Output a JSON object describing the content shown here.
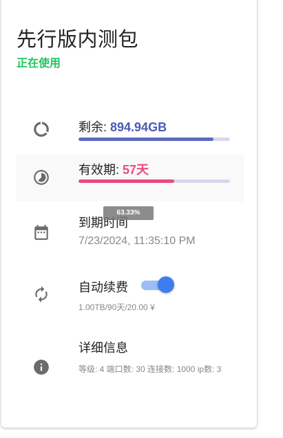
{
  "plan": {
    "title": "先行版内测包",
    "status": "正在使用"
  },
  "remaining": {
    "label": "剩余: ",
    "value": "894.94GB",
    "progress": 0.89,
    "bar_color": "#5b6abf",
    "icon": "progress-circle-icon"
  },
  "validity": {
    "label": "有效期: ",
    "value": "57天",
    "progress": 0.63,
    "bar_color": "#e94b83",
    "icon": "timelapse-icon"
  },
  "expiry": {
    "label": "到期时间",
    "value": "7/23/2024, 11:35:10 PM",
    "tooltip": "63.33%",
    "icon": "calendar-icon"
  },
  "auto_renew": {
    "label": "自动续费",
    "enabled": true,
    "detail": "1.00TB/90天/20.00 ¥",
    "icon": "autorenew-icon"
  },
  "details": {
    "label": "详细信息",
    "text": "等级: 4 端口数: 30 连接数: 1000 ip数: 3",
    "icon": "info-icon"
  },
  "colors": {
    "status": "#22c55e",
    "accent_blue": "#4b5bb5",
    "accent_pink": "#e94b83",
    "toggle": "#3d7df0"
  }
}
